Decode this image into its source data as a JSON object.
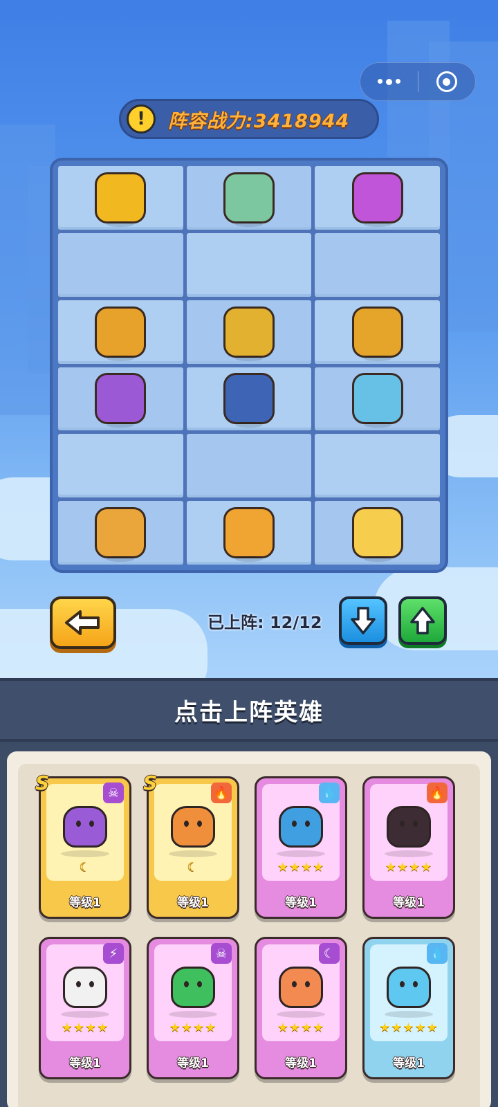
{
  "power": {
    "label": "阵容战力:3418944",
    "icon": "!"
  },
  "board": {
    "rows": [
      [
        {
          "name": "winged-knight",
          "color": "#f1b820"
        },
        {
          "name": "panda-archer",
          "color": "#7cc6a0"
        },
        {
          "name": "purple-mech",
          "color": "#c055d9"
        }
      ],
      [
        null,
        null,
        null
      ],
      [
        {
          "name": "gold-dragon",
          "color": "#e7a22b"
        },
        {
          "name": "gold-stag",
          "color": "#e2b130"
        },
        {
          "name": "gold-serpent",
          "color": "#e4a52a"
        }
      ],
      [
        {
          "name": "purple-dragon",
          "color": "#9b59d6"
        },
        {
          "name": "goggle-mage",
          "color": "#3d64b5"
        },
        {
          "name": "trident-king",
          "color": "#67c1e6"
        }
      ],
      [
        null,
        null,
        null
      ],
      [
        {
          "name": "golden-phoenix",
          "color": "#eaa63b"
        },
        {
          "name": "lion-beast",
          "color": "#f0a431"
        },
        {
          "name": "light-princess",
          "color": "#f7cd4d"
        }
      ]
    ]
  },
  "deploy": {
    "label": "已上阵: 12/12"
  },
  "section_title": "点击上阵英雄",
  "cards": [
    {
      "rarity": "gold",
      "s_badge": "S",
      "element_icon": "skull-icon",
      "element_glyph": "☠",
      "element_color": "#a64dd1",
      "pet_color": "#9a5bd6",
      "grade": "☾",
      "level": "等级1"
    },
    {
      "rarity": "gold",
      "s_badge": "S",
      "element_icon": "fire-icon",
      "element_glyph": "🔥",
      "element_color": "#f2683a",
      "pet_color": "#f08f3b",
      "grade": "☾",
      "level": "等级1"
    },
    {
      "rarity": "pink",
      "s_badge": "",
      "element_icon": "water-icon",
      "element_glyph": "💧",
      "element_color": "#58b6f2",
      "pet_color": "#3f9fe0",
      "grade": "★★★★",
      "level": "等级1"
    },
    {
      "rarity": "pink",
      "s_badge": "",
      "element_icon": "fire-icon",
      "element_glyph": "🔥",
      "element_color": "#f2683a",
      "pet_color": "#3e2c35",
      "grade": "★★★★",
      "level": "等级1"
    },
    {
      "rarity": "pink",
      "s_badge": "",
      "element_icon": "lightning-icon",
      "element_glyph": "⚡",
      "element_color": "#a64dd1",
      "pet_color": "#f1f1f1",
      "grade": "★★★★",
      "level": "等级1"
    },
    {
      "rarity": "pink",
      "s_badge": "",
      "element_icon": "skull-icon",
      "element_glyph": "☠",
      "element_color": "#a64dd1",
      "pet_color": "#3fbf5e",
      "grade": "★★★★",
      "level": "等级1"
    },
    {
      "rarity": "pink",
      "s_badge": "",
      "element_icon": "moon-icon",
      "element_glyph": "☾",
      "element_color": "#a64dd1",
      "pet_color": "#f28a52",
      "grade": "★★★★",
      "level": "等级1"
    },
    {
      "rarity": "blue",
      "s_badge": "",
      "element_icon": "water-icon",
      "element_glyph": "💧",
      "element_color": "#58b6f2",
      "pet_color": "#5ec8f0",
      "grade": "★★★★★",
      "level": "等级1"
    }
  ]
}
